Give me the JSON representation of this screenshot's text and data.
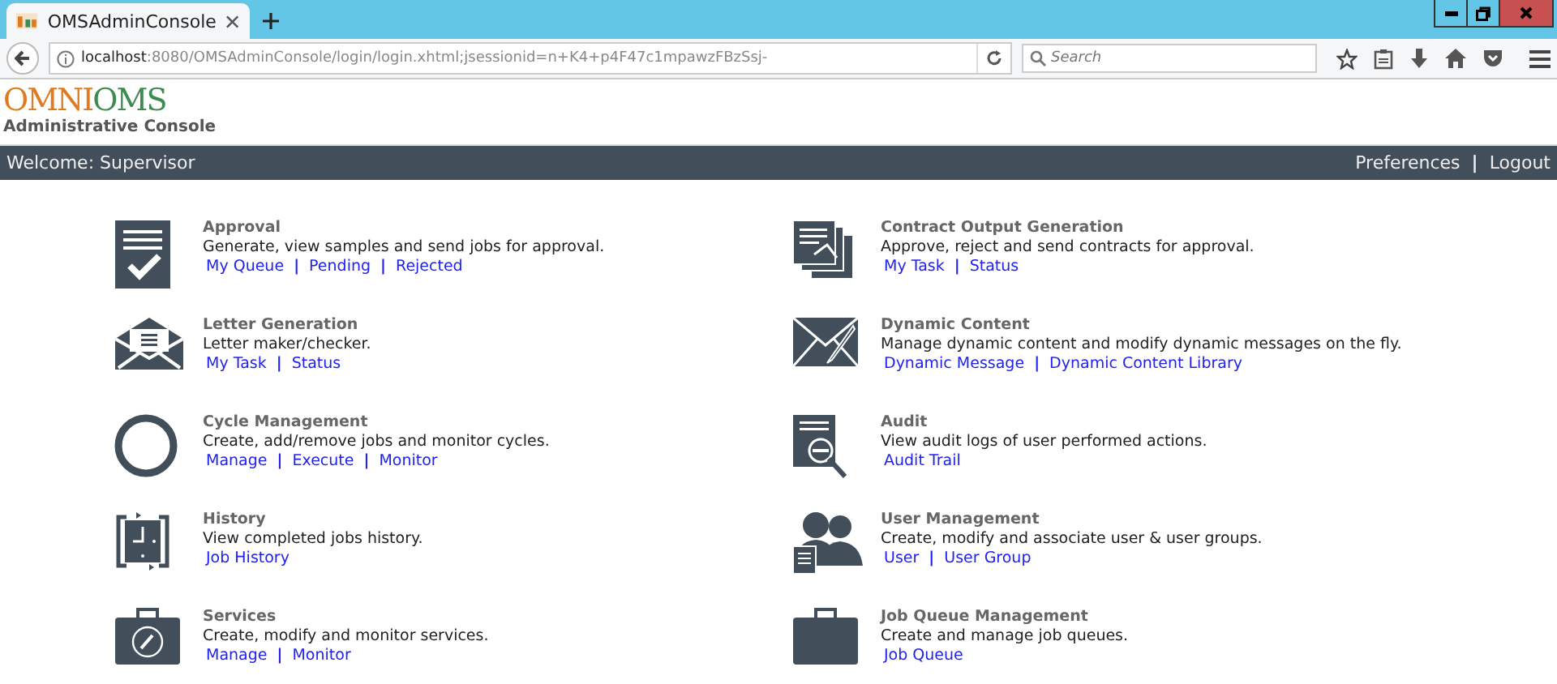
{
  "browser": {
    "tab": {
      "title": "OMSAdminConsole",
      "selected": true
    },
    "url": {
      "host": "localhost",
      "path": ":8080/OMSAdminConsole/login/login.xhtml;jsessionid=n+K4+p4F47c1mpawzFBzSsj-"
    },
    "search": {
      "placeholder": "Search"
    }
  },
  "header": {
    "logo": {
      "part1": "OMNI",
      "part2": "OMS"
    },
    "subtitle": "Administrative Console"
  },
  "nav": {
    "welcome": "Welcome: Supervisor",
    "links": [
      {
        "kind": "link",
        "label": "Preferences"
      },
      {
        "kind": "separator",
        "label": "|"
      },
      {
        "kind": "link",
        "label": "Logout"
      }
    ]
  },
  "modules": [
    {
      "title": "Approval",
      "description": "Generate, view samples and send jobs for approval.",
      "links": [
        {
          "kind": "link",
          "label": "My Queue"
        },
        {
          "kind": "separator",
          "label": "|"
        },
        {
          "kind": "link",
          "label": "Pending"
        },
        {
          "kind": "separator",
          "label": "|"
        },
        {
          "kind": "link",
          "label": "Rejected"
        }
      ]
    },
    {
      "title": "Contract Output Generation",
      "description": "Approve, reject and send contracts for approval.",
      "links": [
        {
          "kind": "link",
          "label": "My Task"
        },
        {
          "kind": "separator",
          "label": "|"
        },
        {
          "kind": "link",
          "label": "Status"
        }
      ]
    },
    {
      "title": "Letter Generation",
      "description": "Letter maker/checker.",
      "links": [
        {
          "kind": "link",
          "label": "My Task"
        },
        {
          "kind": "separator",
          "label": "|"
        },
        {
          "kind": "link",
          "label": "Status"
        }
      ]
    },
    {
      "title": "Dynamic Content",
      "description": "Manage dynamic content and modify dynamic messages on the fly.",
      "links": [
        {
          "kind": "link",
          "label": "Dynamic Message"
        },
        {
          "kind": "separator",
          "label": "|"
        },
        {
          "kind": "link",
          "label": "Dynamic Content Library"
        }
      ]
    },
    {
      "title": "Cycle Management",
      "description": "Create, add/remove jobs and monitor cycles.",
      "links": [
        {
          "kind": "link",
          "label": "Manage"
        },
        {
          "kind": "separator",
          "label": "|"
        },
        {
          "kind": "link",
          "label": "Execute"
        },
        {
          "kind": "separator",
          "label": "|"
        },
        {
          "kind": "link",
          "label": "Monitor"
        }
      ]
    },
    {
      "title": "Audit",
      "description": "View audit logs of user performed actions.",
      "links": [
        {
          "kind": "link",
          "label": "Audit Trail"
        }
      ]
    },
    {
      "title": "History",
      "description": "View completed jobs history.",
      "links": [
        {
          "kind": "link",
          "label": "Job History"
        }
      ]
    },
    {
      "title": "User Management",
      "description": "Create, modify and associate user & user groups.",
      "links": [
        {
          "kind": "link",
          "label": "User"
        },
        {
          "kind": "separator",
          "label": "|"
        },
        {
          "kind": "link",
          "label": "User Group"
        }
      ]
    },
    {
      "title": "Services",
      "description": "Create, modify and monitor services.",
      "links": [
        {
          "kind": "link",
          "label": "Manage"
        },
        {
          "kind": "separator",
          "label": "|"
        },
        {
          "kind": "link",
          "label": "Monitor"
        }
      ]
    },
    {
      "title": "Job Queue Management",
      "description": "Create and manage job queues.",
      "links": [
        {
          "kind": "link",
          "label": "Job Queue"
        }
      ]
    }
  ]
}
